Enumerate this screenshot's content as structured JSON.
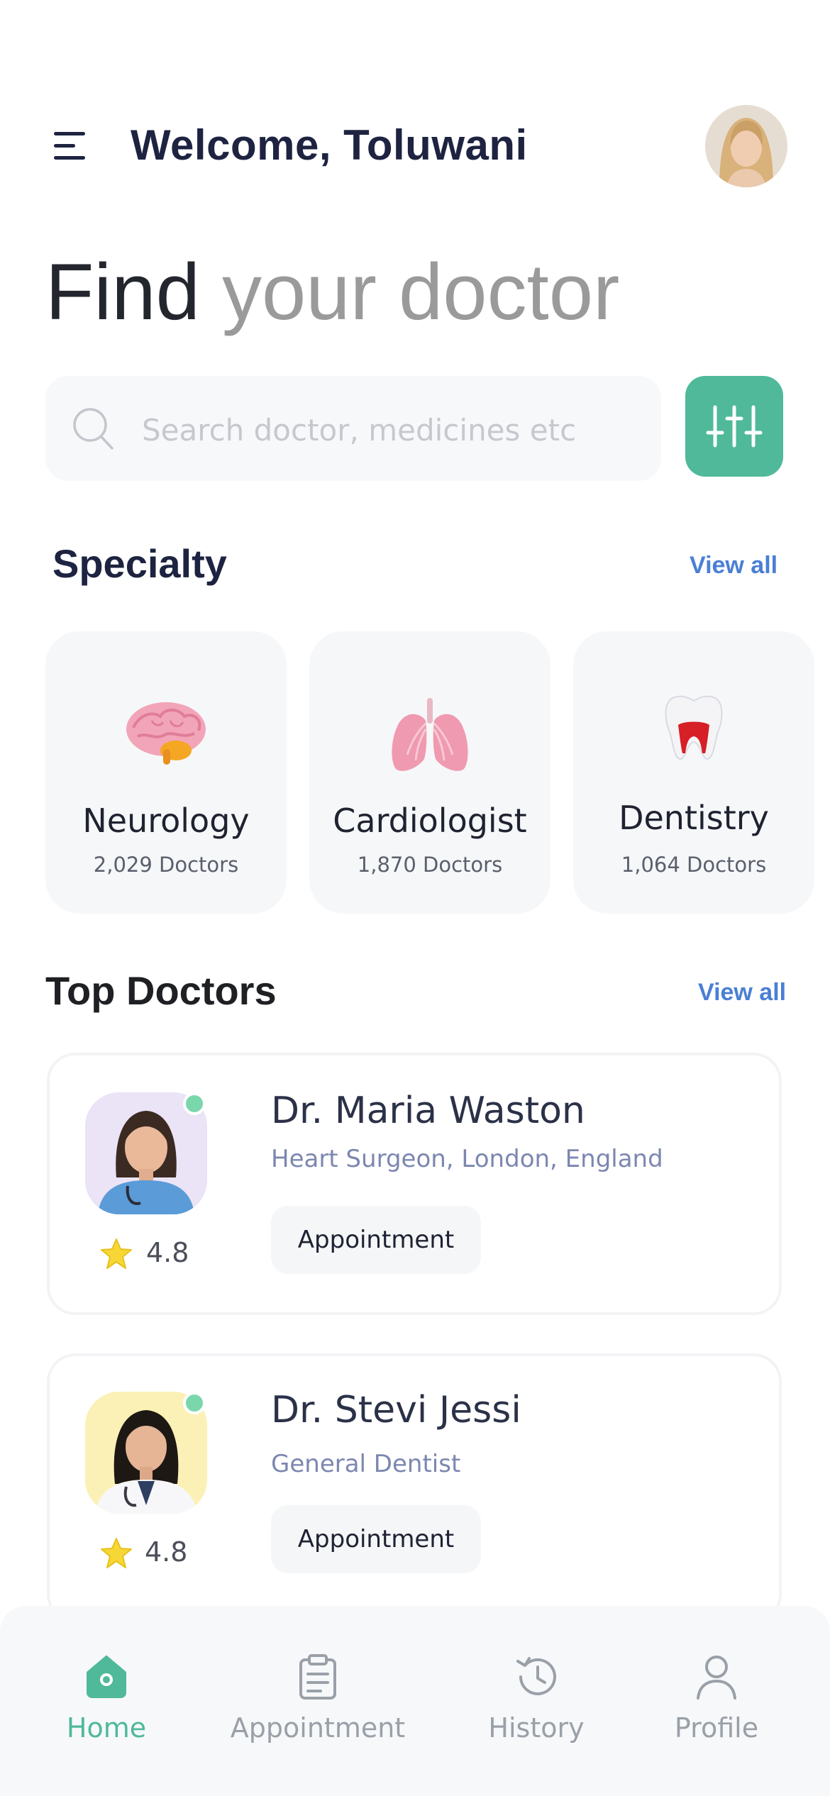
{
  "header": {
    "greeting": "Welcome, Toluwani"
  },
  "hero": {
    "headline_dark": "Find",
    "headline_light": "your doctor"
  },
  "search": {
    "placeholder": "Search doctor, medicines etc"
  },
  "specialty": {
    "title": "Specialty",
    "view_all": "View all",
    "items": [
      {
        "name": "Neurology",
        "count": "2,029 Doctors",
        "icon": "brain-icon"
      },
      {
        "name": "Cardiologist",
        "count": "1,870 Doctors",
        "icon": "lungs-icon"
      },
      {
        "name": "Dentistry",
        "count": "1,064 Doctors",
        "icon": "tooth-icon"
      }
    ]
  },
  "top_doctors": {
    "title": "Top Doctors",
    "view_all": "View all",
    "items": [
      {
        "name": "Dr. Maria Waston",
        "specialty": "Heart Surgeon, London, England",
        "rating": "4.8",
        "button": "Appointment"
      },
      {
        "name": "Dr. Stevi Jessi",
        "specialty": "General Dentist",
        "rating": "4.8",
        "button": "Appointment"
      }
    ]
  },
  "nav": {
    "items": [
      {
        "label": "Home",
        "icon": "home-icon",
        "active": true
      },
      {
        "label": "Appointment",
        "icon": "clipboard-icon",
        "active": false
      },
      {
        "label": "History",
        "icon": "history-icon",
        "active": false
      },
      {
        "label": "Profile",
        "icon": "profile-icon",
        "active": false
      }
    ]
  },
  "colors": {
    "accent": "#4fb99a",
    "link": "#4a7fd4",
    "title": "#1d2340",
    "online": "#7ad7ac"
  }
}
